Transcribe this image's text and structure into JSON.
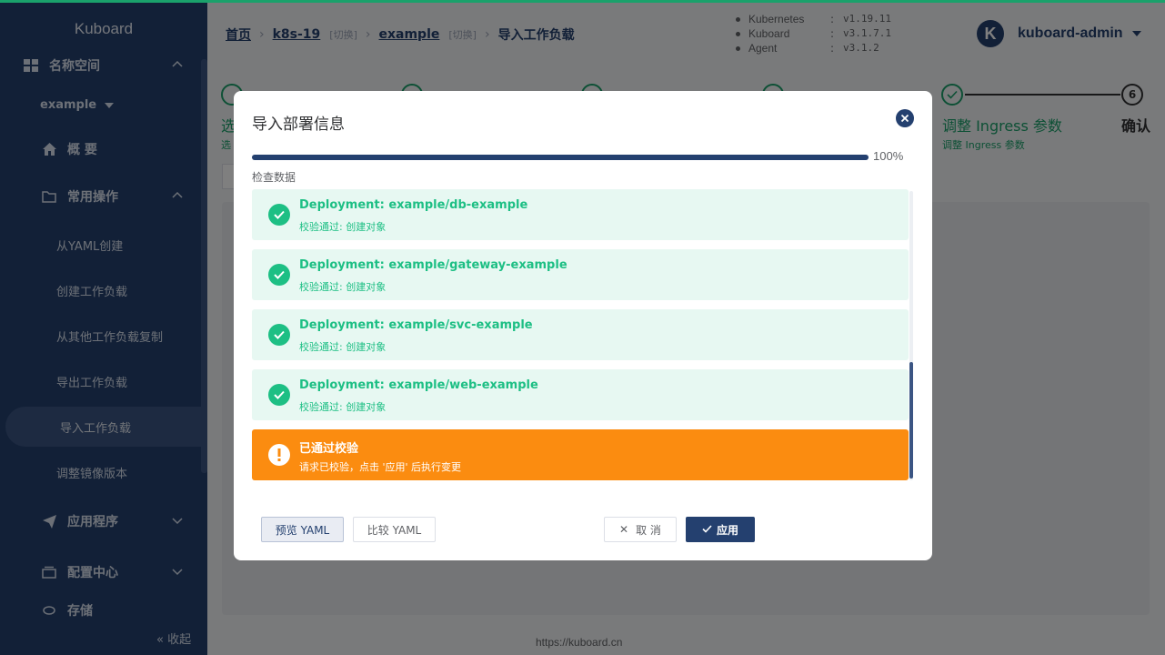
{
  "app": {
    "brand": "Kuboard",
    "footer_url": "https://kuboard.cn"
  },
  "sidebar": {
    "namespace_section": "名称空间",
    "namespace_selected": "example",
    "overview": "概 要",
    "common_ops": "常用操作",
    "items": [
      "从YAML创建",
      "创建工作负载",
      "从其他工作负载复制",
      "导出工作负载",
      "导入工作负载",
      "调整镜像版本"
    ],
    "active_item": "导入工作负载",
    "apps": "应用程序",
    "config_center": "配置中心",
    "storage": "存储",
    "collapse": "收起"
  },
  "header": {
    "breadcrumb": {
      "home": "首页",
      "cluster": "k8s-19",
      "switch1": "[切换]",
      "namespace": "example",
      "switch2": "[切换]",
      "current": "导入工作负载"
    },
    "versions": [
      {
        "name": "Kubernetes",
        "value": "v1.19.11"
      },
      {
        "name": "Kuboard",
        "value": "v3.1.7.1"
      },
      {
        "name": "Agent",
        "value": "v3.1.2"
      }
    ],
    "user": {
      "avatar_letter": "K",
      "name": "kuboard-admin"
    }
  },
  "steps": {
    "step1_title": "选",
    "step1_desc": "选",
    "step5_title": "调整 Ingress 参数",
    "step5_desc": "调整 Ingress 参数",
    "step6_number": "6",
    "step6_title": "确认"
  },
  "dialog": {
    "title": "导入部署信息",
    "progress": {
      "percent": 100,
      "label": "100%"
    },
    "section_label": "检查数据",
    "results": [
      {
        "title": "Deployment: example/db-example",
        "desc": "校验通过: 创建对象"
      },
      {
        "title": "Deployment: example/gateway-example",
        "desc": "校验通过: 创建对象"
      },
      {
        "title": "Deployment: example/svc-example",
        "desc": "校验通过: 创建对象"
      },
      {
        "title": "Deployment: example/web-example",
        "desc": "校验通过: 创建对象"
      }
    ],
    "warning": {
      "title": "已通过校验",
      "desc": "请求已校验，点击 '应用' 后执行变更"
    },
    "buttons": {
      "preview": "预览 YAML",
      "compare": "比较 YAML",
      "cancel": "取 消",
      "apply": "应用"
    }
  },
  "colors": {
    "primary": "#24406f",
    "success": "#1dbf84",
    "warning": "#fb8c10",
    "step_green": "#1aa16b"
  }
}
